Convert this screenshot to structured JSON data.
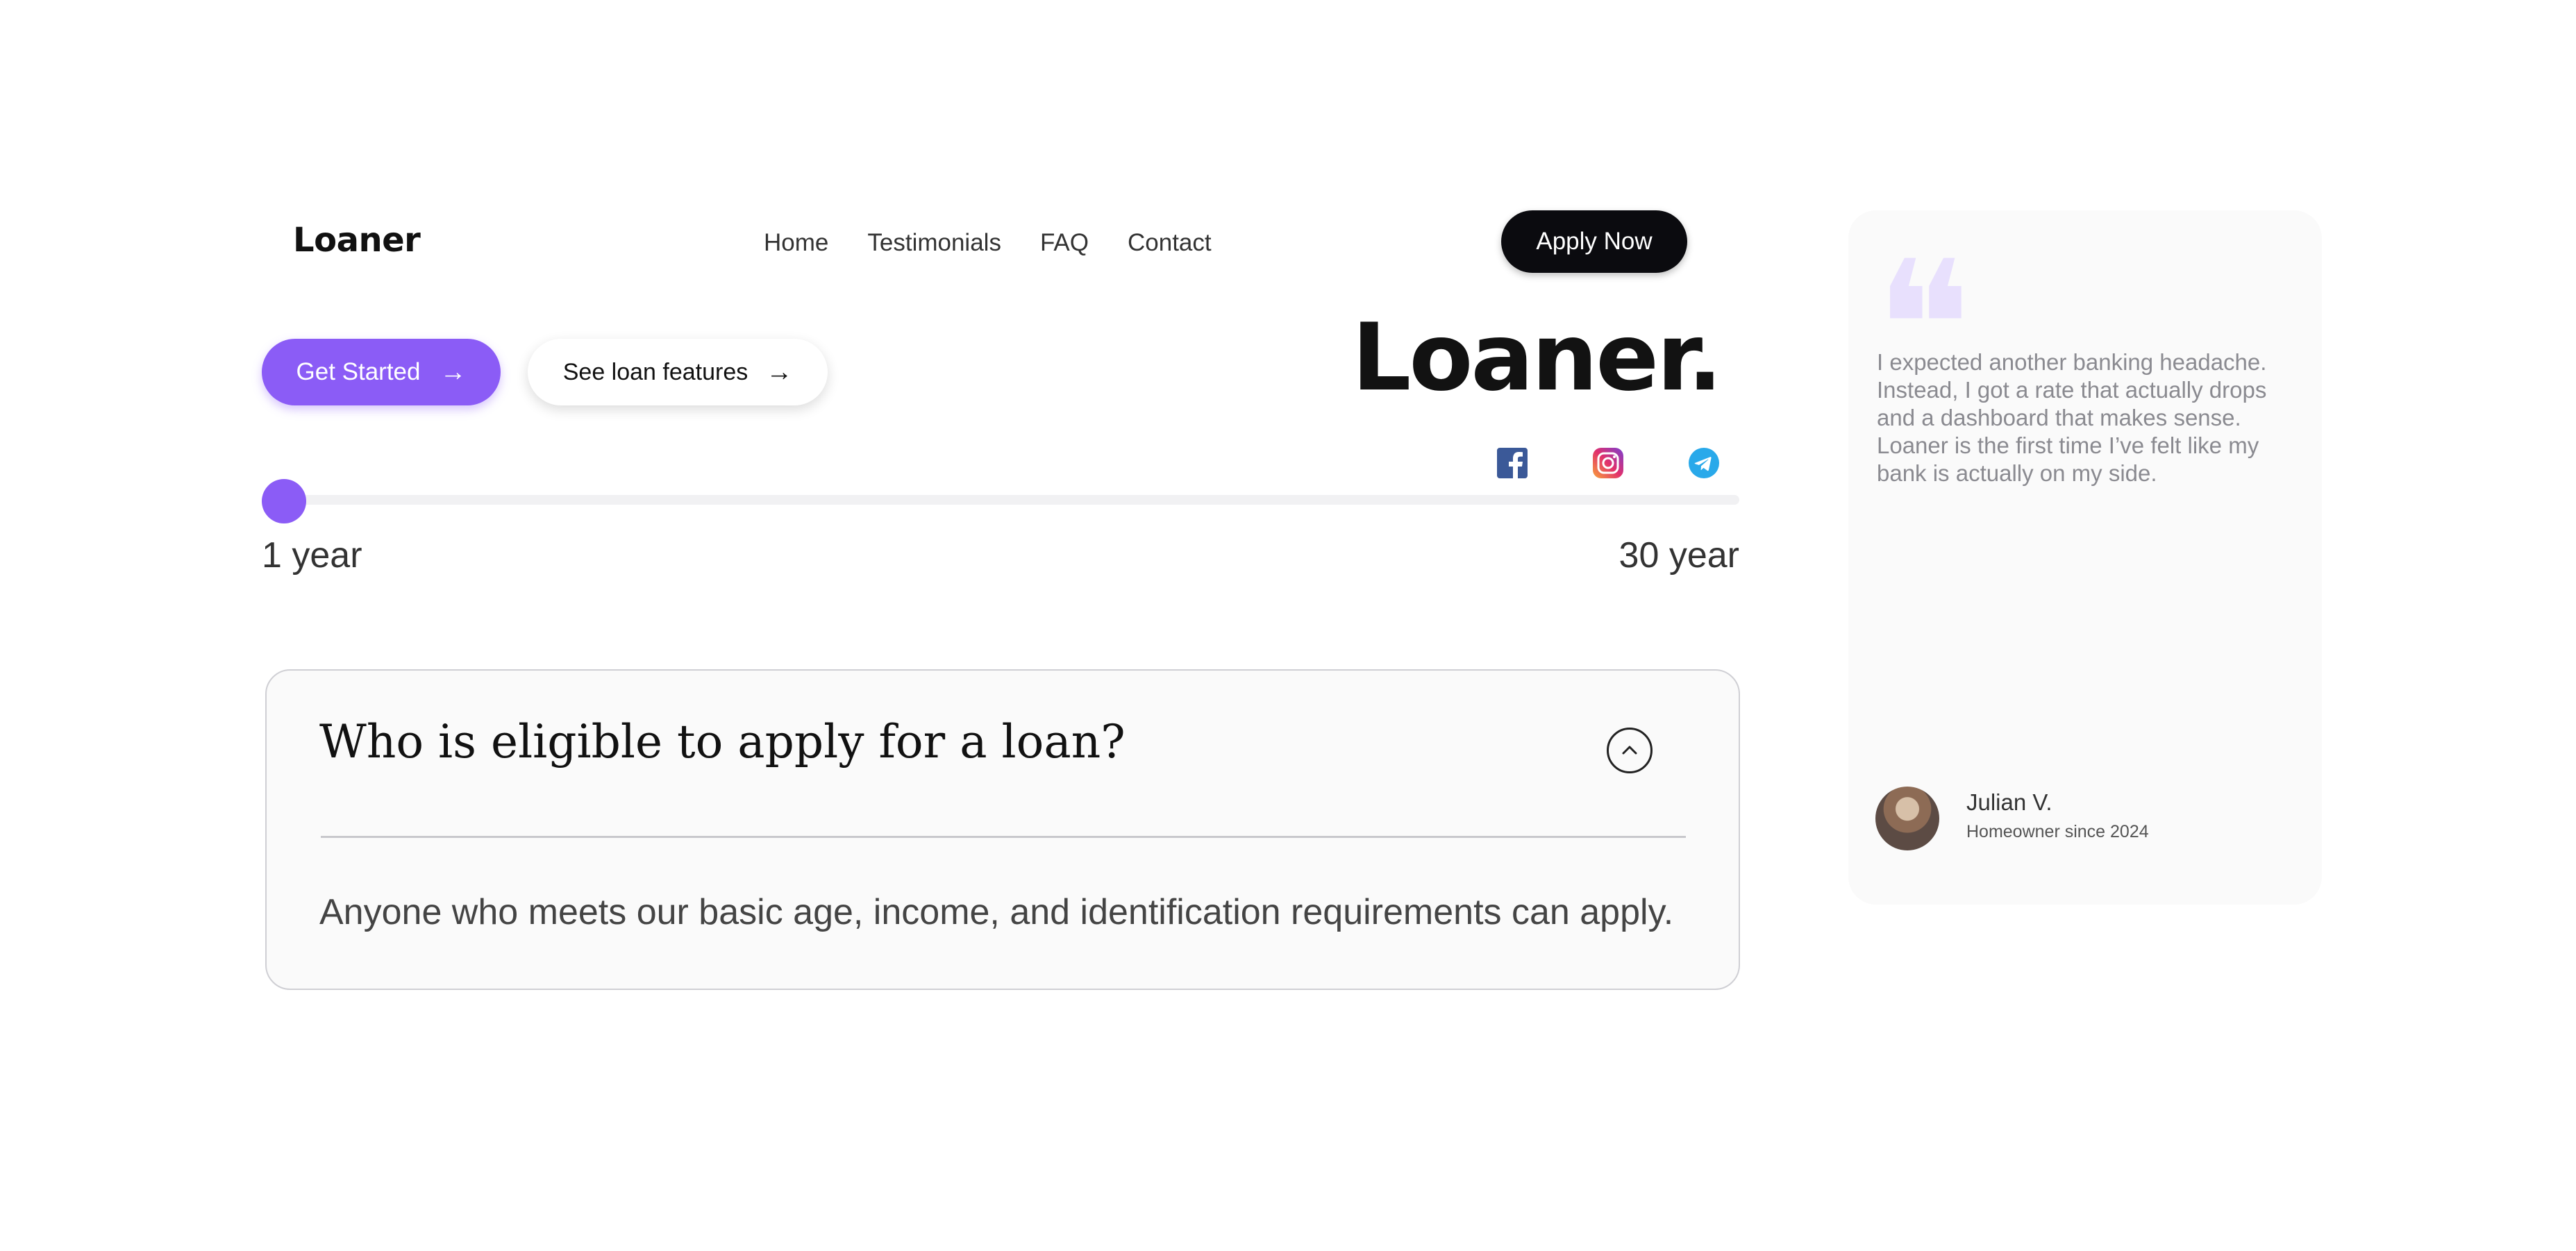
{
  "header": {
    "logo": "Loaner",
    "nav": [
      {
        "label": "Home"
      },
      {
        "label": "Testimonials"
      },
      {
        "label": "FAQ"
      },
      {
        "label": "Contact"
      }
    ],
    "apply_label": "Apply Now"
  },
  "hero": {
    "get_started_label": "Get Started",
    "see_features_label": "See loan features",
    "brand_title": "Loaner.",
    "socials": [
      {
        "icon": "facebook-icon",
        "color": "#3b5998"
      },
      {
        "icon": "instagram-icon",
        "color": "#c13584"
      },
      {
        "icon": "telegram-icon",
        "color": "#29a9ea"
      }
    ]
  },
  "slider": {
    "min_label": "1 year",
    "max_label": "30 year",
    "value_fraction": 0,
    "accent": "#8b5cf6"
  },
  "faq": {
    "question": "Who is eligible to apply for a loan?",
    "answer": "Anyone who meets our basic age, income, and identification requirements can apply.",
    "expanded": true
  },
  "testimonial": {
    "quote": "I expected another banking headache. Instead, I got a rate that actually drops and a dashboard that makes sense. Loaner is the first time I’ve felt like my bank is actually on my side.",
    "name": "Julian V.",
    "subtitle": "Homeowner since 2024"
  }
}
